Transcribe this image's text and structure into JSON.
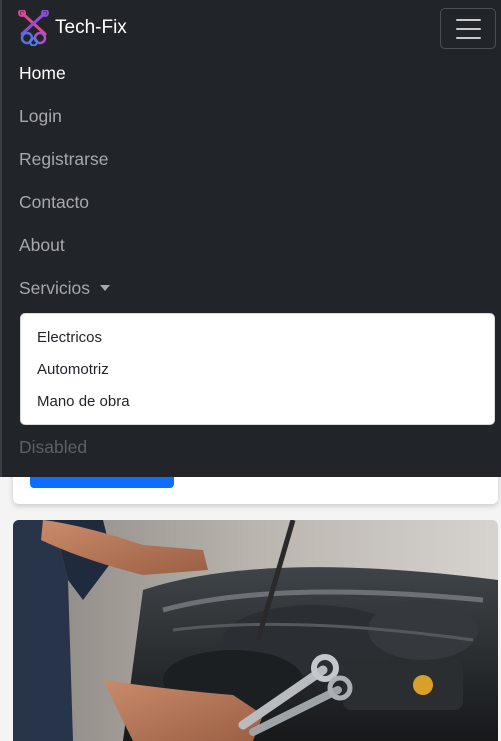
{
  "navbar": {
    "brand": "Tech-Fix",
    "items": [
      {
        "label": "Home",
        "state": "active"
      },
      {
        "label": "Login"
      },
      {
        "label": "Registrarse"
      },
      {
        "label": "Contacto"
      },
      {
        "label": "About"
      }
    ],
    "services": {
      "label": "Servicios",
      "options": [
        "Electricos",
        "Automotriz",
        "Mano de obra"
      ]
    },
    "disabled_label": "Disabled"
  },
  "colors": {
    "navbar_bg": "#212529",
    "primary": "#0d6efd"
  },
  "icons": {
    "brand": "wrench-gears-icon",
    "toggler": "hamburger-menu-icon",
    "dropdown": "caret-down-icon"
  }
}
